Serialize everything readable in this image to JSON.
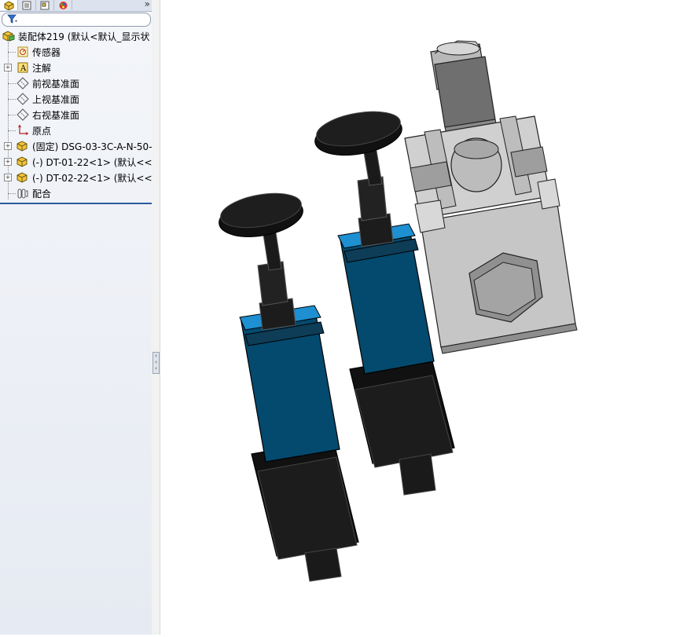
{
  "panel": {
    "tabs": [
      {
        "name": "featuremanager-tab",
        "icon": "assembly-tree-icon"
      },
      {
        "name": "propertymanager-tab",
        "icon": "property-icon"
      },
      {
        "name": "configurationmanager-tab",
        "icon": "configuration-icon"
      },
      {
        "name": "displaymanager-tab",
        "icon": "appearance-icon"
      }
    ],
    "more_label": "»",
    "filter_icon": "filter-icon"
  },
  "tree": {
    "root": "装配体219 (默认<默认_显示状",
    "items": [
      {
        "label": "传感器",
        "icon": "sensor-icon",
        "expandable": false
      },
      {
        "label": "注解",
        "icon": "annotation-icon",
        "expandable": true
      },
      {
        "label": "前视基准面",
        "icon": "plane-icon",
        "expandable": false
      },
      {
        "label": "上视基准面",
        "icon": "plane-icon",
        "expandable": false
      },
      {
        "label": "右视基准面",
        "icon": "plane-icon",
        "expandable": false
      },
      {
        "label": "原点",
        "icon": "origin-icon",
        "expandable": false
      },
      {
        "label": "(固定) DSG-03-3C-A-N-50-",
        "icon": "part-icon",
        "expandable": true
      },
      {
        "label": "(-) DT-01-22<1> (默认<<默",
        "icon": "part-icon",
        "expandable": true
      },
      {
        "label": "(-) DT-02-22<1> (默认<<默",
        "icon": "part-icon",
        "expandable": true
      },
      {
        "label": "配合",
        "icon": "mates-icon",
        "expandable": false
      }
    ]
  },
  "colors": {
    "panel_bg": "#eef1f6",
    "separator": "#2c5aa0",
    "valve_body": "#c8c8c8",
    "valve_dark": "#808080",
    "knob": "#1a1a1a",
    "blue_housing": "#034a6e",
    "blue_cap": "#1e8fd0"
  }
}
